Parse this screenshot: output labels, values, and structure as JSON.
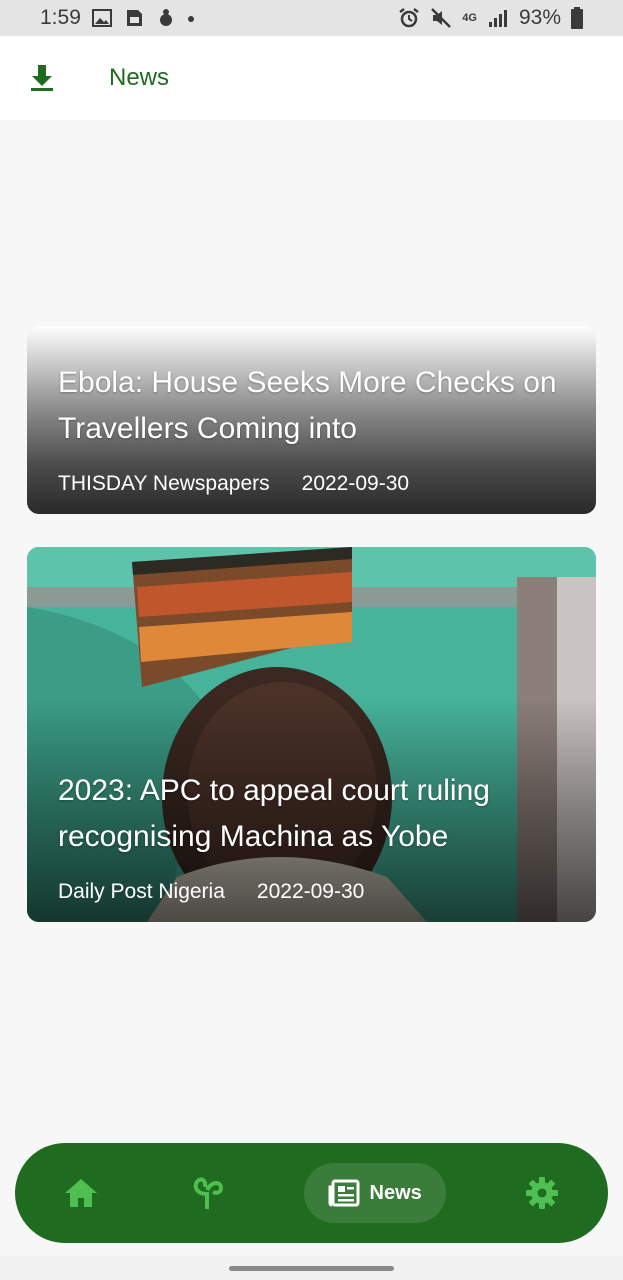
{
  "status_bar": {
    "time": "1:59",
    "network": "4G",
    "battery": "93%",
    "left_icons": [
      "gallery-icon",
      "sim-card-icon",
      "bug-icon",
      "dot-icon"
    ],
    "right_icons": [
      "alarm-icon",
      "mute-icon",
      "network-4g-icon",
      "signal-icon",
      "battery-icon"
    ]
  },
  "app_bar": {
    "title": "News",
    "download_icon": "download-icon"
  },
  "articles": [
    {
      "title": "Ebola: House Seeks More Checks on Travellers Coming into",
      "source": "THISDAY Newspapers",
      "date": "2022-09-30"
    },
    {
      "title": "2023: APC to appeal court ruling recognising Machina as Yobe",
      "source": "Daily Post Nigeria",
      "date": "2022-09-30"
    }
  ],
  "bottom_nav": {
    "items": [
      {
        "icon": "home-icon"
      },
      {
        "icon": "plant-icon"
      },
      {
        "icon": "newspaper-icon",
        "label": "News",
        "active": true
      },
      {
        "icon": "gear-icon"
      }
    ]
  },
  "colors": {
    "primary": "#1f6b1f",
    "background": "#f7f7f7",
    "nav_icon": "#4fbf52"
  }
}
